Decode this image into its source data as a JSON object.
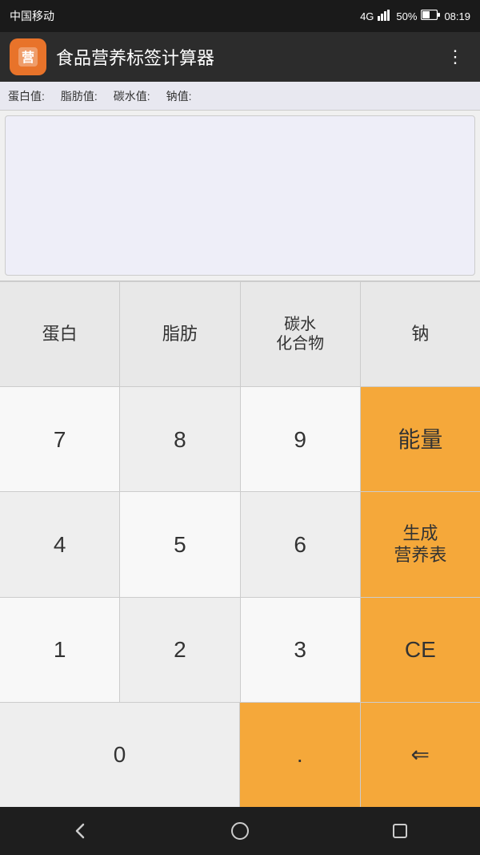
{
  "statusBar": {
    "carrier": "中国移动",
    "network": "4G",
    "signal": "📶",
    "battery": "50%",
    "time": "08:19"
  },
  "appBar": {
    "title": "食品营养标签计算器",
    "menuIcon": "⋮"
  },
  "infoBar": {
    "labels": [
      "蛋白值:",
      "脂肪值:",
      "碳水值:",
      "钠值:"
    ]
  },
  "keypad": {
    "categories": [
      "蛋白",
      "脂肪",
      "碳水\n化合物",
      "钠"
    ],
    "row1": [
      "7",
      "8",
      "9",
      "能量"
    ],
    "row2": [
      "4",
      "5",
      "6",
      "生成\n营养表"
    ],
    "row3": [
      "1",
      "2",
      "3",
      "CE"
    ],
    "row4_left": "0",
    "row4_dot": ".",
    "row4_del": "⇐"
  },
  "navBar": {
    "back": "back",
    "home": "home",
    "square": "square"
  }
}
